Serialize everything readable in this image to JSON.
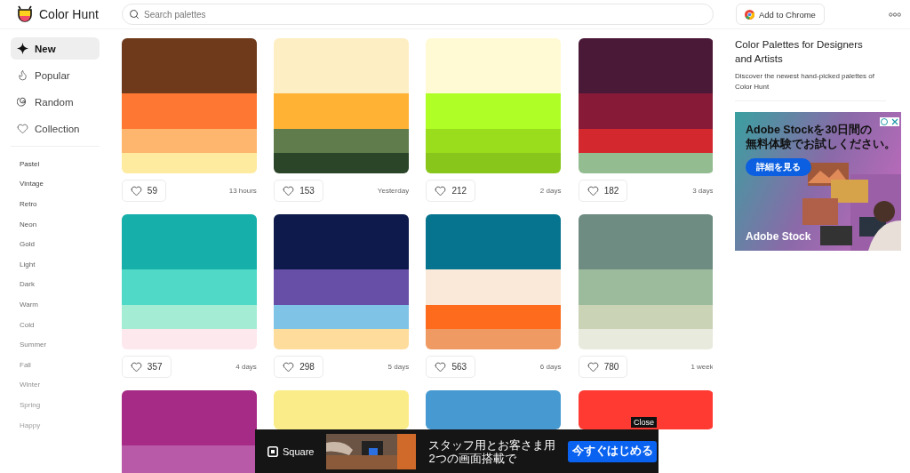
{
  "header": {
    "logo": "Color Hunt",
    "search": {
      "placeholder": "Search palettes"
    },
    "chrome_button": "Add to Chrome"
  },
  "sidebar": {
    "nav": [
      {
        "kind": "new",
        "label": "New",
        "selected": true
      },
      {
        "kind": "popular",
        "label": "Popular",
        "selected": false
      },
      {
        "kind": "random",
        "label": "Random",
        "selected": false
      },
      {
        "kind": "collection",
        "label": "Collection",
        "selected": false
      }
    ],
    "tags": [
      "Pastel",
      "Vintage",
      "Retro",
      "Neon",
      "Gold",
      "Light",
      "Dark",
      "Warm",
      "Cold",
      "Summer",
      "Fall",
      "Winter",
      "Spring",
      "Happy"
    ]
  },
  "palettes": [
    {
      "swatches": [
        {
          "color": "#6f3a1c"
        },
        {
          "color": "#fe7733"
        },
        {
          "color": "#feb56d"
        },
        {
          "color": "#feeba0"
        }
      ],
      "likes": "59",
      "age": "13 hours"
    },
    {
      "swatches": [
        {
          "color": "#feeec4"
        },
        {
          "color": "#ffb234"
        },
        {
          "color": "#607b4c"
        },
        {
          "color": "#2b4529"
        }
      ],
      "likes": "153",
      "age": "Yesterday"
    },
    {
      "swatches": [
        {
          "color": "#fffad4"
        },
        {
          "color": "#afff26"
        },
        {
          "color": "#99dd1d"
        },
        {
          "color": "#88c61b"
        }
      ],
      "likes": "212",
      "age": "2 days"
    },
    {
      "swatches": [
        {
          "color": "#4a1938"
        },
        {
          "color": "#861a37"
        },
        {
          "color": "#d4282f"
        },
        {
          "color": "#93bc90"
        }
      ],
      "likes": "182",
      "age": "3 days"
    },
    {
      "swatches": [
        {
          "color": "#16afaa"
        },
        {
          "color": "#4fd9c6"
        },
        {
          "color": "#a4ecd4"
        },
        {
          "color": "#fde8ee"
        }
      ],
      "likes": "357",
      "age": "4 days"
    },
    {
      "swatches": [
        {
          "color": "#0d1a4b"
        },
        {
          "color": "#674ea6"
        },
        {
          "color": "#7fc3e7"
        },
        {
          "color": "#fedc9c"
        }
      ],
      "likes": "298",
      "age": "5 days"
    },
    {
      "swatches": [
        {
          "color": "#07748f"
        },
        {
          "color": "#fae9d8"
        },
        {
          "color": "#fe6b1d"
        },
        {
          "color": "#f09a63"
        }
      ],
      "likes": "563",
      "age": "6 days"
    },
    {
      "swatches": [
        {
          "color": "#6e8c82"
        },
        {
          "color": "#9cba9c"
        },
        {
          "color": "#cbd3b7"
        },
        {
          "color": "#e8eadd"
        }
      ],
      "likes": "780",
      "age": "1 week"
    },
    {
      "swatches": [
        {
          "color": "#a62b86"
        },
        {
          "color": "#b95aa8"
        }
      ]
    },
    {
      "swatches": [
        {
          "color": "#fbec8a"
        }
      ]
    },
    {
      "swatches": [
        {
          "color": "#4699d1"
        }
      ]
    },
    {
      "swatches": [
        {
          "color": "#fe3a33"
        }
      ]
    }
  ],
  "aside": {
    "title": "Color Palettes for Designers and Artists",
    "description": "Discover the newest hand-picked palettes of Color Hunt"
  },
  "side_ad": {
    "headline_lines": [
      "Adobe Stockを30日間の",
      "無料体験でお試しください。"
    ],
    "button": "詳細を見る",
    "brand": "Adobe Stock"
  },
  "bottom_ad": {
    "brand": "Square",
    "headline_lines": [
      "スタッフ用とお客さま用",
      "2つの画面搭載で"
    ],
    "button": "今すぐはじめる",
    "close": "Close"
  }
}
